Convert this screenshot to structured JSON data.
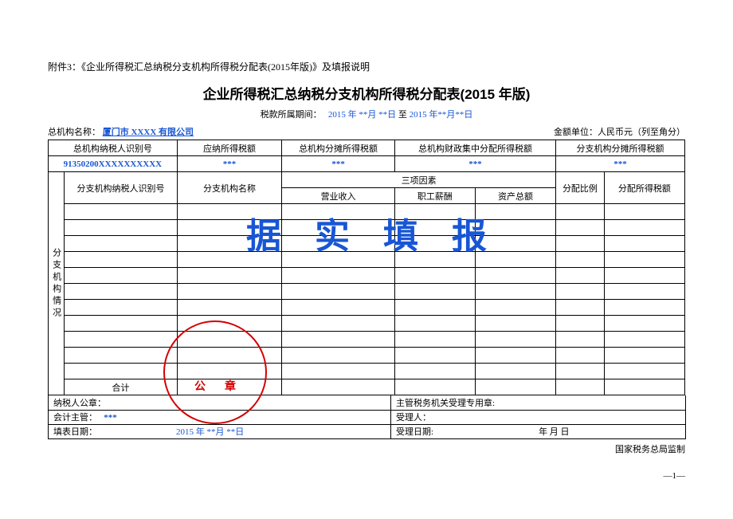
{
  "attachment_label": "附件3：《企业所得税汇总纳税分支机构所得税分配表(2015年版)》及填报说明",
  "title": "企业所得税汇总纳税分支机构所得税分配表(2015 年版)",
  "period": {
    "prefix": "税款所属期间：",
    "from": "2015 年 **月 **日",
    "mid": " 至 ",
    "to": "2015 年**月**日"
  },
  "org_label": "总机构名称：",
  "org_name": "厦门市 XXXX 有限公司",
  "currency_label": "金额单位：人民币元（列至角分）",
  "header_row1": {
    "c1": "总机构纳税人识别号",
    "c2": "应纳所得税额",
    "c3": "总机构分摊所得税额",
    "c4": "总机构财政集中分配所得税额",
    "c5": "分支机构分摊所得税额"
  },
  "data_row1": {
    "c1": "91350200XXXXXXXXXX",
    "c2": "***",
    "c3": "***",
    "c4": "***",
    "c5": "***"
  },
  "header_row2": {
    "side": "分支机构情况",
    "c1": "分支机构纳税人识别号",
    "c2": "分支机构名称",
    "c3_group": "三项因素",
    "c3a": "营业收入",
    "c3b": "职工薪酬",
    "c3c": "资产总额",
    "c4": "分配比例",
    "c5": "分配所得税额"
  },
  "total_label": "合计",
  "footer": {
    "seal_label": "纳税人公章：",
    "auth_label": "主管税务机关受理专用章:",
    "accountant_label": "会计主管：",
    "accountant_val": "***",
    "receiver_label": "受理人：",
    "fill_date_label": "填表日期：",
    "fill_date_val": "2015 年 **月 **日",
    "receive_date_label": "受理日期:",
    "receive_date_val": "年        月         日"
  },
  "bottom_note": "国家税务总局监制",
  "page_num": "—1—",
  "watermark": "据实填报",
  "stamp_text": "公章"
}
